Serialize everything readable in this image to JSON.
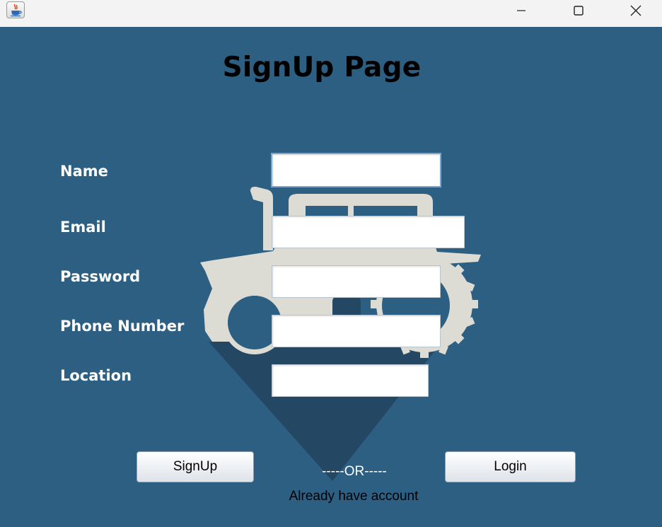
{
  "window": {
    "app_icon": "java-cup-icon",
    "controls": [
      "minimize-icon",
      "maximize-icon",
      "close-icon"
    ]
  },
  "page": {
    "title": "SignUp Page",
    "background_color": "#2d5f83",
    "background_art": "tractor-pin-logo"
  },
  "form": {
    "name_label": "Name",
    "email_label": "Email",
    "password_label": "Password",
    "phone_label": "Phone Number",
    "location_label": "Location",
    "name_value": "",
    "email_value": "",
    "password_value": "",
    "phone_value": "",
    "location_value": ""
  },
  "actions": {
    "signup_label": "SignUp",
    "or_text": "-----OR-----",
    "login_label": "Login",
    "already_text": "Already have account"
  }
}
